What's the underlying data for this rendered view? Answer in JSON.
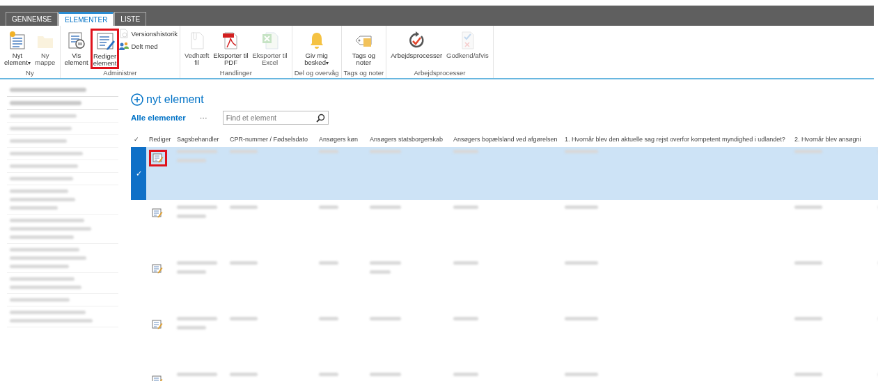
{
  "tabs": [
    {
      "label": "GENNEMSE",
      "selected": false
    },
    {
      "label": "ELEMENTER",
      "selected": true
    },
    {
      "label": "LISTE",
      "selected": false
    }
  ],
  "ribbon": [
    {
      "group": "Ny",
      "buttons": [
        {
          "label": [
            "Nyt",
            "element"
          ],
          "caret": "▾",
          "disabled": false,
          "highlighted": false
        },
        {
          "label": [
            "Ny",
            "mappe"
          ],
          "disabled": true,
          "highlighted": false
        }
      ]
    },
    {
      "group": "Administrer",
      "buttons": [
        {
          "label": [
            "Vis",
            "element"
          ],
          "disabled": false,
          "highlighted": false
        },
        {
          "label": [
            "Rediger",
            "element"
          ],
          "disabled": false,
          "highlighted": true
        }
      ],
      "small": [
        {
          "label": "Versionshistorik",
          "disabled": true
        },
        {
          "label": "Delt med",
          "disabled": false
        }
      ]
    },
    {
      "group": "Handlinger",
      "buttons": [
        {
          "label": [
            "Vedhæft",
            "fil"
          ],
          "disabled": true,
          "highlighted": false
        },
        {
          "label": [
            "Eksporter til",
            "PDF"
          ],
          "disabled": false,
          "highlighted": false
        },
        {
          "label": [
            "Eksporter til",
            "Excel"
          ],
          "disabled": true,
          "highlighted": false
        }
      ]
    },
    {
      "group": "Del og overvåg",
      "buttons": [
        {
          "label": [
            "Giv mig",
            "besked"
          ],
          "caret": "▾",
          "disabled": false,
          "highlighted": false
        }
      ]
    },
    {
      "group": "Tags og noter",
      "buttons": [
        {
          "label": [
            "Tags og",
            "noter"
          ],
          "disabled": false,
          "highlighted": false
        }
      ]
    },
    {
      "group": "Arbejdsprocesser",
      "buttons": [
        {
          "label": [
            "Arbejdsprocesser"
          ],
          "disabled": false,
          "highlighted": false
        },
        {
          "label": [
            "Godkend/afvis"
          ],
          "disabled": true,
          "highlighted": false
        }
      ]
    }
  ],
  "sidebar": [
    {
      "kind": "heading1"
    },
    {
      "kind": "heading1"
    },
    {
      "kind": "line1"
    },
    {
      "kind": "line1"
    },
    {
      "kind": "line1"
    },
    {
      "kind": "line1"
    },
    {
      "kind": "line1"
    },
    {
      "kind": "line1"
    },
    {
      "kind": "line3"
    },
    {
      "kind": "line3"
    },
    {
      "kind": "line3"
    },
    {
      "kind": "line2"
    },
    {
      "kind": "line1"
    },
    {
      "kind": "line2"
    }
  ],
  "new_item": "nyt element",
  "view": "Alle elementer",
  "more": "···",
  "search": {
    "placeholder": "Find et element"
  },
  "table": {
    "columns": [
      "✓",
      "Rediger",
      "Sagsbehandler",
      "CPR-nummer / Fødselsdato",
      "Ansøgers køn",
      "Ansøgers statsborgerskab",
      "Ansøgers bopælsland ved afgørelsen",
      "1. Hvornår blev den aktuelle sag rejst overfor kompetent myndighed i udlandet?",
      "2. Hvornår blev ansøgni"
    ],
    "selection_mark": "✓",
    "rows": [
      {
        "selected": true,
        "edit_highlighted": true,
        "cells": [
          {
            "kind": "two"
          },
          {
            "kind": "one"
          },
          {
            "kind": "one"
          },
          {
            "kind": "one"
          },
          {
            "kind": "one"
          },
          {
            "kind": "one"
          },
          {
            "kind": "one"
          }
        ]
      },
      {
        "selected": false,
        "edit_highlighted": false,
        "cells": [
          {
            "kind": "two"
          },
          {
            "kind": "one"
          },
          {
            "kind": "one"
          },
          {
            "kind": "one"
          },
          {
            "kind": "one"
          },
          {
            "kind": "one"
          },
          {
            "kind": "one"
          }
        ]
      },
      {
        "selected": false,
        "edit_highlighted": false,
        "cells": [
          {
            "kind": "two"
          },
          {
            "kind": "one"
          },
          {
            "kind": "one"
          },
          {
            "kind": "two"
          },
          {
            "kind": "one"
          },
          {
            "kind": "one"
          },
          {
            "kind": "one"
          }
        ]
      },
      {
        "selected": false,
        "edit_highlighted": false,
        "cells": [
          {
            "kind": "two"
          },
          {
            "kind": "one"
          },
          {
            "kind": "one"
          },
          {
            "kind": "one"
          },
          {
            "kind": "one"
          },
          {
            "kind": "one"
          },
          {
            "kind": "one"
          }
        ]
      },
      {
        "selected": false,
        "edit_highlighted": false,
        "cells": [
          {
            "kind": "one"
          },
          {
            "kind": "one"
          },
          {
            "kind": "one"
          },
          {
            "kind": "one"
          },
          {
            "kind": "one"
          },
          {
            "kind": "one"
          },
          {
            "kind": "one"
          }
        ]
      }
    ]
  }
}
